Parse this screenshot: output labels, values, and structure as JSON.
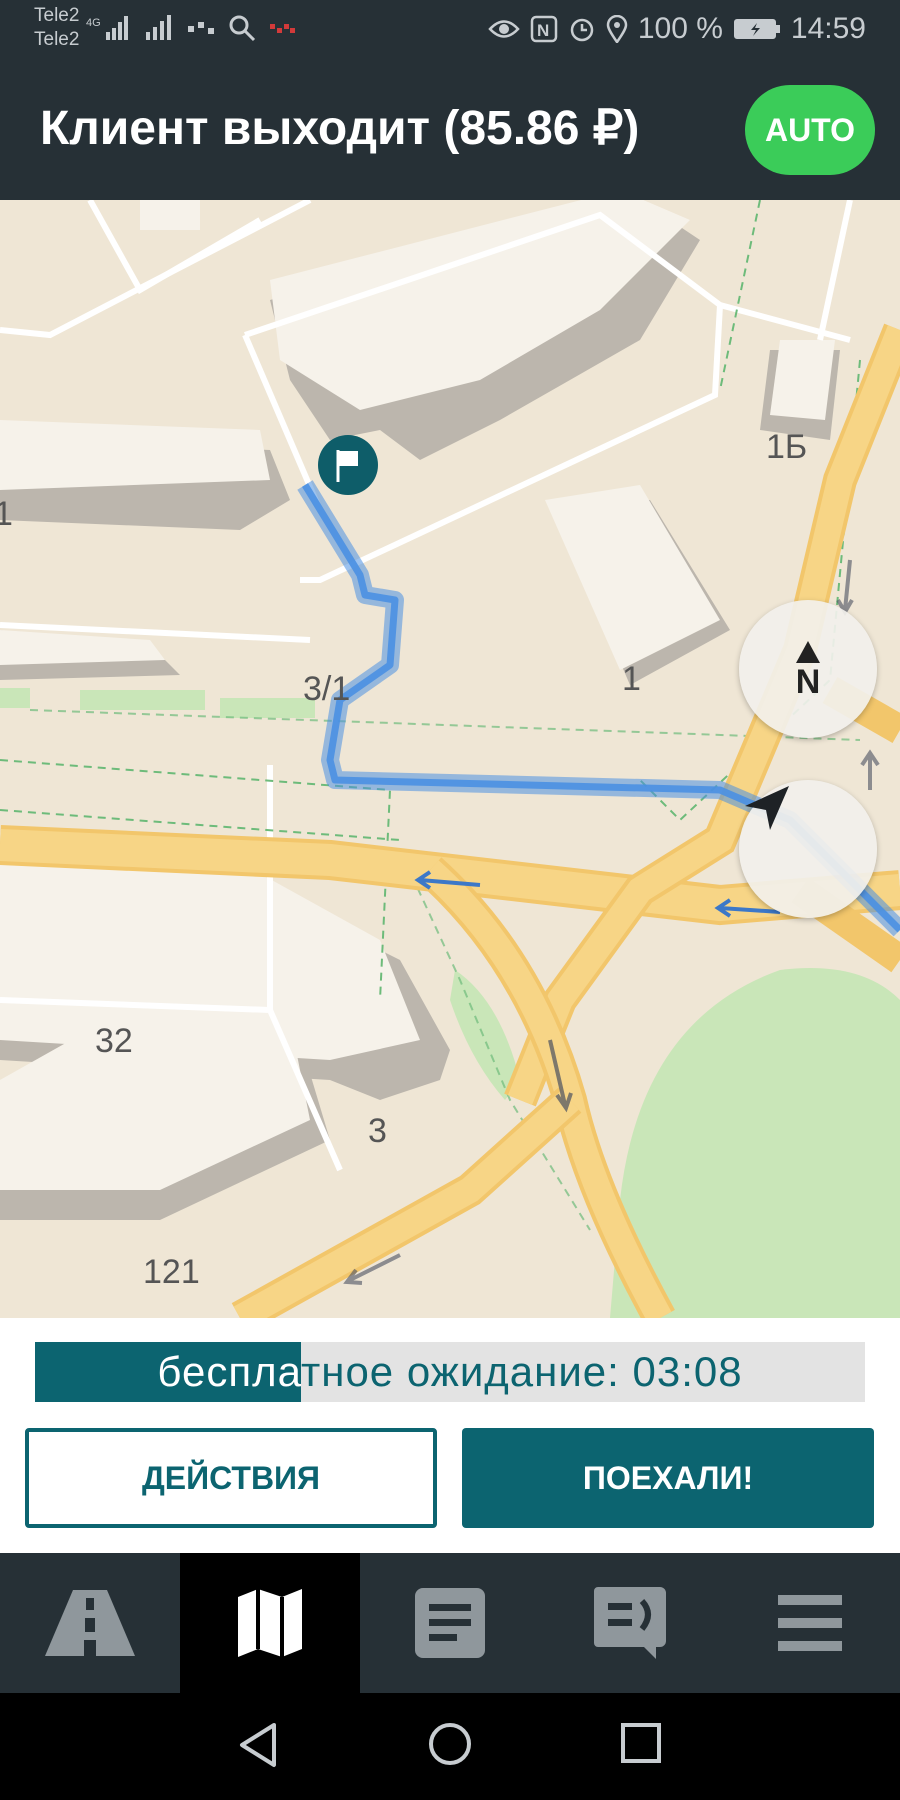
{
  "status_bar": {
    "carrier1": "Tele2",
    "carrier2": "Tele2",
    "battery": "100 %",
    "time": "14:59"
  },
  "header": {
    "title": "Клиент выходит (85.86 ₽)",
    "auto_label": "AUTO"
  },
  "map": {
    "labels": {
      "b1b": "1Б",
      "b1": "1",
      "b31": "3/1",
      "b32": "32",
      "b3": "3",
      "b121": "121",
      "edge": "1"
    },
    "compass_label": "N",
    "icons": [
      "flag-marker-icon",
      "compass-icon",
      "locate-arrow-icon"
    ]
  },
  "wait": {
    "label": "бесплатное ожидание: 03:08",
    "progress": 0.32
  },
  "buttons": {
    "actions": "ДЕЙСТВИЯ",
    "go": "ПОЕХАЛИ!"
  },
  "tabs": [
    "road-icon",
    "map-icon",
    "document-icon",
    "chat-icon",
    "menu-icon"
  ],
  "tab_active": 1,
  "colors": {
    "accent": "#0c6470",
    "auto": "#3bcc59",
    "header": "#263036",
    "route": "#4a90e2"
  }
}
